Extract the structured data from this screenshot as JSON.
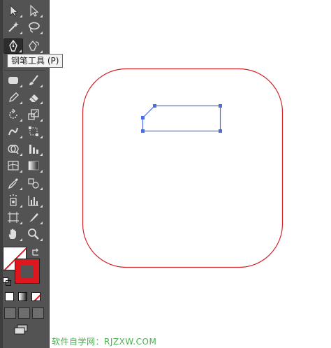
{
  "tooltip": {
    "text": "钢笔工具 (P)"
  },
  "watermark": {
    "text": "软件自学网：RJZXW.COM"
  },
  "tools": [
    {
      "row": 0,
      "col": 0,
      "name": "selection-tool-icon",
      "glyph": "arrow-white"
    },
    {
      "row": 0,
      "col": 1,
      "name": "direct-selection-tool-icon",
      "glyph": "arrow-hollow"
    },
    {
      "row": 1,
      "col": 0,
      "name": "magic-wand-tool-icon",
      "glyph": "wand"
    },
    {
      "row": 1,
      "col": 1,
      "name": "lasso-tool-icon",
      "glyph": "lasso"
    },
    {
      "row": 2,
      "col": 0,
      "name": "pen-tool-icon",
      "glyph": "pen"
    },
    {
      "row": 2,
      "col": 1,
      "name": "type-tool-icon",
      "glyph": "pen-curve"
    },
    {
      "row": 4,
      "col": 0,
      "name": "rounded-rectangle-tool-icon",
      "glyph": "roundrect"
    },
    {
      "row": 4,
      "col": 1,
      "name": "paintbrush-tool-icon",
      "glyph": "brush"
    },
    {
      "row": 5,
      "col": 0,
      "name": "pencil-tool-icon",
      "glyph": "pencil"
    },
    {
      "row": 5,
      "col": 1,
      "name": "eraser-tool-icon",
      "glyph": "eraser"
    },
    {
      "row": 6,
      "col": 0,
      "name": "rotate-tool-icon",
      "glyph": "rotate"
    },
    {
      "row": 6,
      "col": 1,
      "name": "scale-tool-icon",
      "glyph": "scale"
    },
    {
      "row": 7,
      "col": 0,
      "name": "warp-tool-icon",
      "glyph": "warp"
    },
    {
      "row": 7,
      "col": 1,
      "name": "free-transform-tool-icon",
      "glyph": "freetransform"
    },
    {
      "row": 8,
      "col": 0,
      "name": "shape-builder-tool-icon",
      "glyph": "shapebuilder"
    },
    {
      "row": 8,
      "col": 1,
      "name": "graph-tool-icon",
      "glyph": "graph"
    },
    {
      "row": 9,
      "col": 0,
      "name": "mesh-tool-icon",
      "glyph": "mesh"
    },
    {
      "row": 9,
      "col": 1,
      "name": "gradient-tool-icon",
      "glyph": "gradient"
    },
    {
      "row": 10,
      "col": 0,
      "name": "eyedropper-tool-icon",
      "glyph": "eyedropper"
    },
    {
      "row": 10,
      "col": 1,
      "name": "blend-tool-icon",
      "glyph": "blend"
    },
    {
      "row": 11,
      "col": 0,
      "name": "symbol-sprayer-tool-icon",
      "glyph": "sprayer"
    },
    {
      "row": 11,
      "col": 1,
      "name": "column-graph-tool-icon",
      "glyph": "columns"
    },
    {
      "row": 12,
      "col": 0,
      "name": "artboard-tool-icon",
      "glyph": "artboard"
    },
    {
      "row": 12,
      "col": 1,
      "name": "slice-tool-icon",
      "glyph": "slice"
    },
    {
      "row": 13,
      "col": 0,
      "name": "hand-tool-icon",
      "glyph": "hand"
    },
    {
      "row": 13,
      "col": 1,
      "name": "zoom-tool-icon",
      "glyph": "zoom"
    }
  ],
  "colors": {
    "toolbar_bg": "#535353",
    "shape_stroke": "#d2232a",
    "path_color": "#4a6fe3",
    "stroke_swatch": "#e0161f"
  }
}
